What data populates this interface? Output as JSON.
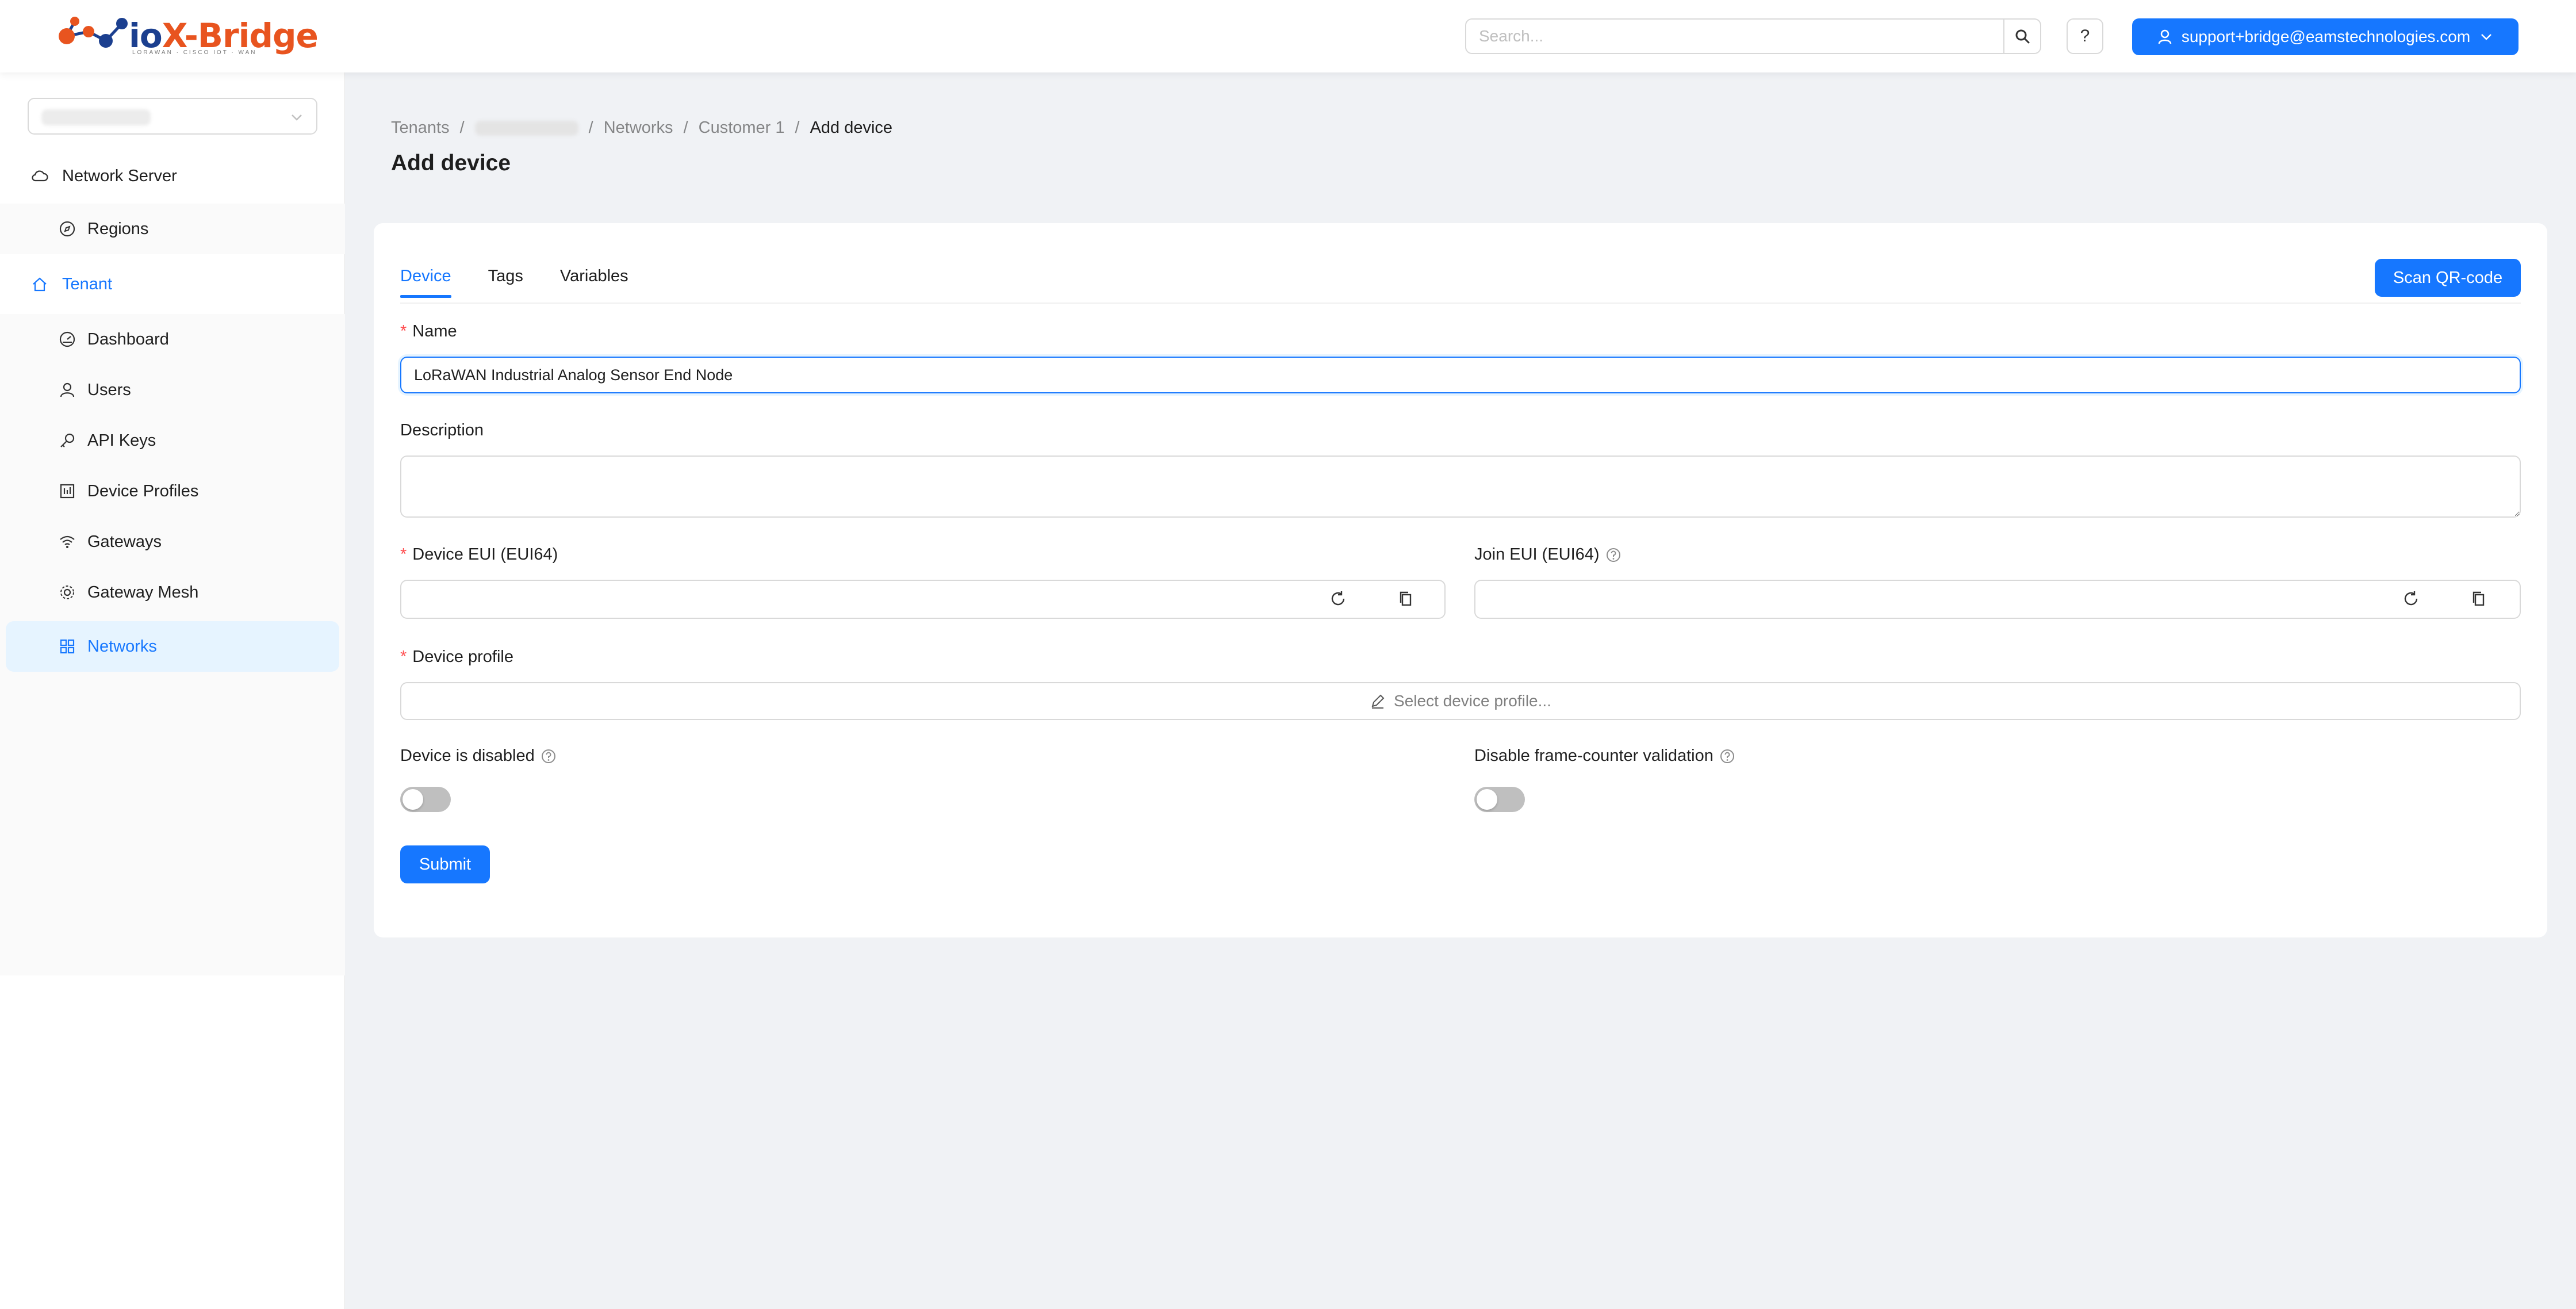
{
  "header": {
    "logo_text_io": "io",
    "logo_text_x": "X",
    "logo_text_rest": "-Bridge",
    "logo_tagline": "LORAWAN · CISCO IOT · WAN",
    "search_placeholder": "Search...",
    "help_label": "?",
    "user_email": "support+bridge@eamstechnologies.com"
  },
  "sidebar": {
    "tenant_selected": "",
    "items": [
      {
        "label": "Network Server",
        "icon": "cloud-icon"
      },
      {
        "label": "Regions",
        "icon": "compass-icon"
      },
      {
        "label": "Tenant",
        "icon": "home-icon"
      },
      {
        "label": "Dashboard",
        "icon": "dashboard-icon"
      },
      {
        "label": "Users",
        "icon": "user-icon"
      },
      {
        "label": "API Keys",
        "icon": "key-icon"
      },
      {
        "label": "Device Profiles",
        "icon": "profile-icon"
      },
      {
        "label": "Gateways",
        "icon": "wifi-icon"
      },
      {
        "label": "Gateway Mesh",
        "icon": "mesh-icon"
      },
      {
        "label": "Networks",
        "icon": "grid-icon"
      }
    ]
  },
  "breadcrumb": {
    "tenants": "Tenants",
    "tenant_name": "",
    "networks": "Networks",
    "customer": "Customer 1",
    "current": "Add device"
  },
  "page": {
    "title": "Add device"
  },
  "tabs": [
    {
      "label": "Device"
    },
    {
      "label": "Tags"
    },
    {
      "label": "Variables"
    }
  ],
  "form": {
    "scan_qr_label": "Scan QR-code",
    "name_label": "Name",
    "name_value": "LoRaWAN Industrial Analog Sensor End Node",
    "description_label": "Description",
    "description_value": "",
    "device_eui_label": "Device EUI (EUI64)",
    "device_eui_value": "",
    "join_eui_label": "Join EUI (EUI64)",
    "join_eui_value": "",
    "device_profile_label": "Device profile",
    "device_profile_placeholder": "Select device profile...",
    "device_disabled_label": "Device is disabled",
    "device_disabled_on": false,
    "disable_fcnt_label": "Disable frame-counter validation",
    "disable_fcnt_on": false,
    "submit_label": "Submit"
  },
  "colors": {
    "primary": "#1677ff",
    "required": "#ff4d4f",
    "logo_blue": "#1b3f8f",
    "logo_orange": "#e8541f"
  }
}
